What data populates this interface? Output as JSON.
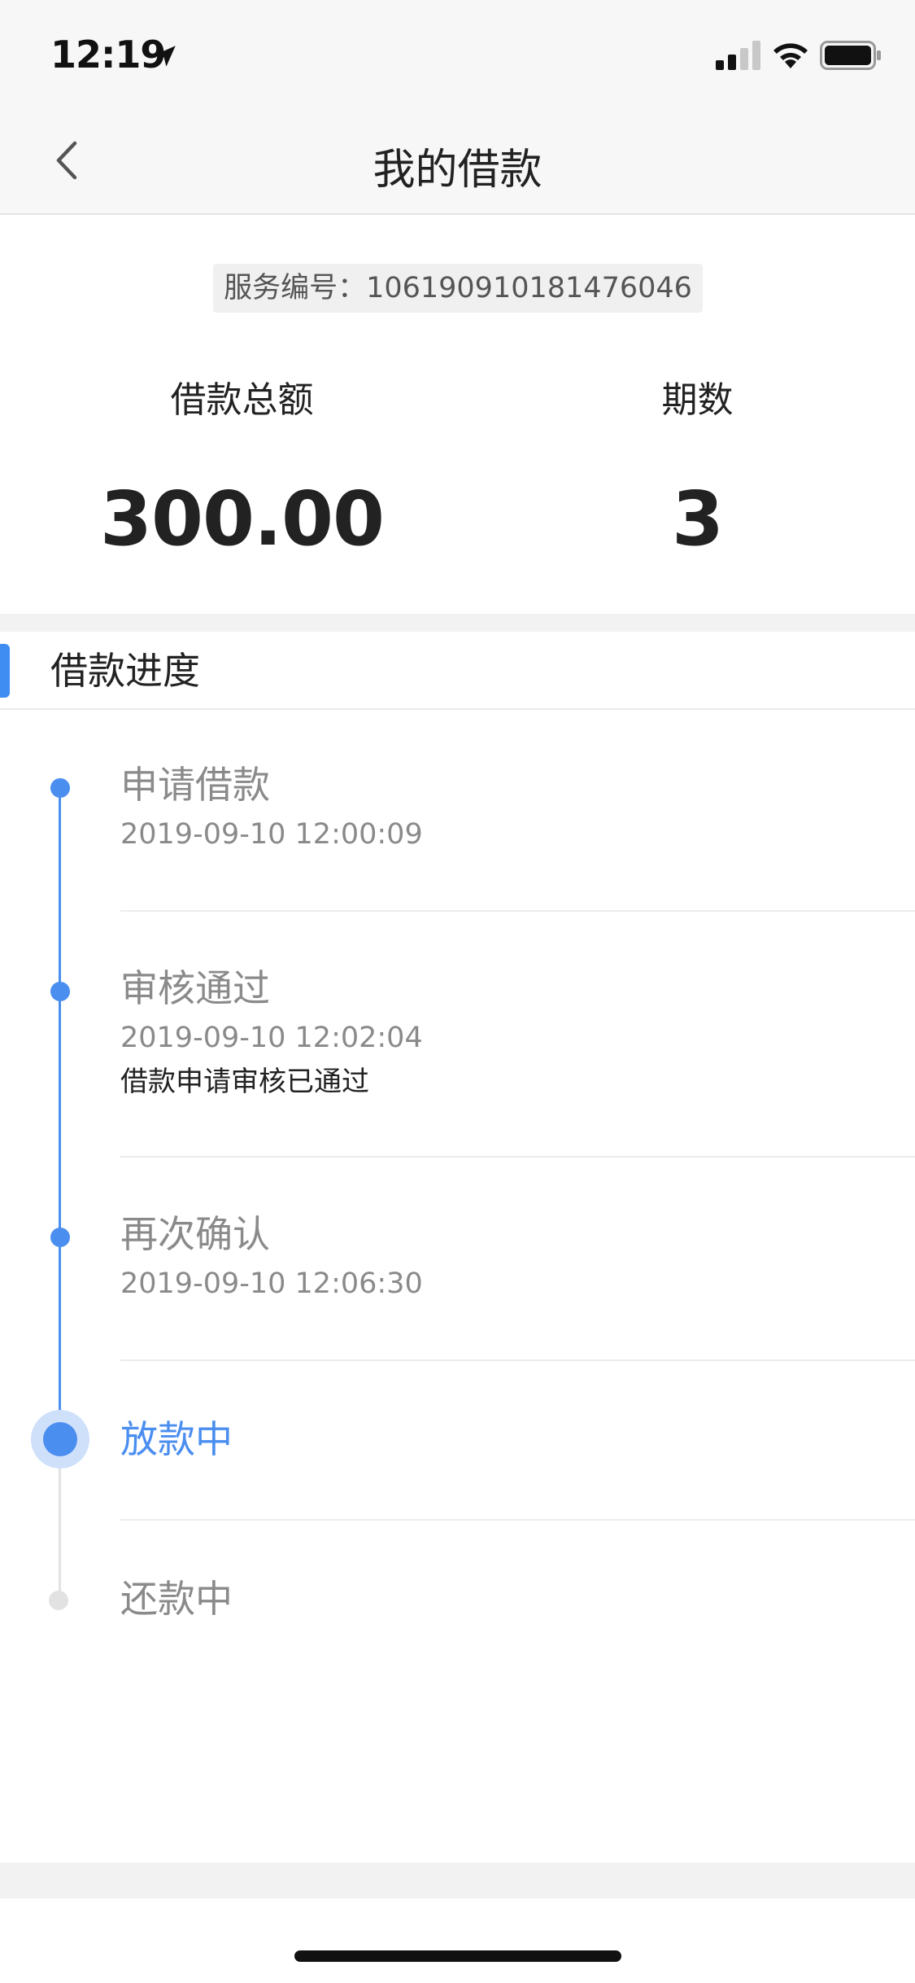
{
  "status_bar": {
    "time": "12:19",
    "icons": [
      "location-arrow-icon",
      "cellular-signal-icon",
      "wifi-icon",
      "battery-icon"
    ]
  },
  "nav": {
    "title": "我的借款",
    "back_icon": "chevron-left-icon"
  },
  "summary": {
    "service_no": "服务编号：106190910181476046",
    "total_label": "借款总额",
    "total_value": "300.00",
    "periods_label": "期数",
    "periods_value": "3"
  },
  "progress": {
    "title": "借款进度",
    "steps": [
      {
        "title": "申请借款",
        "time": "2019-09-10 12:00:09",
        "note": "",
        "state": "done"
      },
      {
        "title": "审核通过",
        "time": "2019-09-10 12:02:04",
        "note": "借款申请审核已通过",
        "state": "done"
      },
      {
        "title": "再次确认",
        "time": "2019-09-10 12:06:30",
        "note": "",
        "state": "done"
      },
      {
        "title": "放款中",
        "time": "",
        "note": "",
        "state": "current"
      },
      {
        "title": "还款中",
        "time": "",
        "note": "",
        "state": "pending"
      }
    ]
  },
  "colors": {
    "accent": "#4a8ef0",
    "inactive_text": "#8a8a8a",
    "pending_dot": "#e2e2e2"
  }
}
